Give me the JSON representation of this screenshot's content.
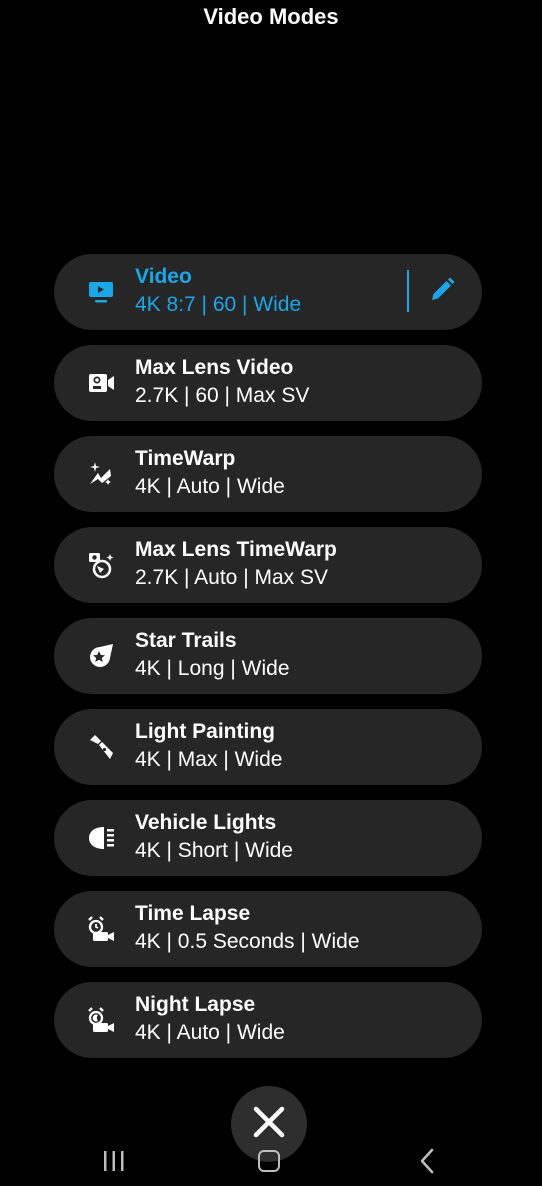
{
  "header": {
    "title": "Video Modes"
  },
  "colors": {
    "accent": "#16a8e8",
    "card": "#262626",
    "background": "#000000"
  },
  "modes": [
    {
      "name": "Video",
      "settings": "4K 8:7 | 60 | Wide",
      "icon": "screen-icon",
      "active": true
    },
    {
      "name": "Max Lens Video",
      "settings": "2.7K | 60 | Max SV",
      "icon": "max-lens-camera-icon"
    },
    {
      "name": "TimeWarp",
      "settings": "4K | Auto | Wide",
      "icon": "timewarp-icon"
    },
    {
      "name": "Max Lens TimeWarp",
      "settings": "2.7K | Auto | Max SV",
      "icon": "max-lens-timewarp-icon"
    },
    {
      "name": "Star Trails",
      "settings": "4K | Long | Wide",
      "icon": "shooting-star-icon"
    },
    {
      "name": "Light Painting",
      "settings": "4K | Max | Wide",
      "icon": "flashlight-icon"
    },
    {
      "name": "Vehicle Lights",
      "settings": "4K | Short | Wide",
      "icon": "headlight-icon"
    },
    {
      "name": "Time Lapse",
      "settings": "4K | 0.5 Seconds | Wide",
      "icon": "alarm-camera-icon"
    },
    {
      "name": "Night Lapse",
      "settings": "4K | Auto | Wide",
      "icon": "night-alarm-camera-icon"
    }
  ],
  "actions": {
    "edit_icon": "pencil-icon",
    "close_icon": "close-icon"
  },
  "navbar": {
    "recents_icon": "recents-icon",
    "home_icon": "home-icon",
    "back_icon": "back-icon"
  }
}
